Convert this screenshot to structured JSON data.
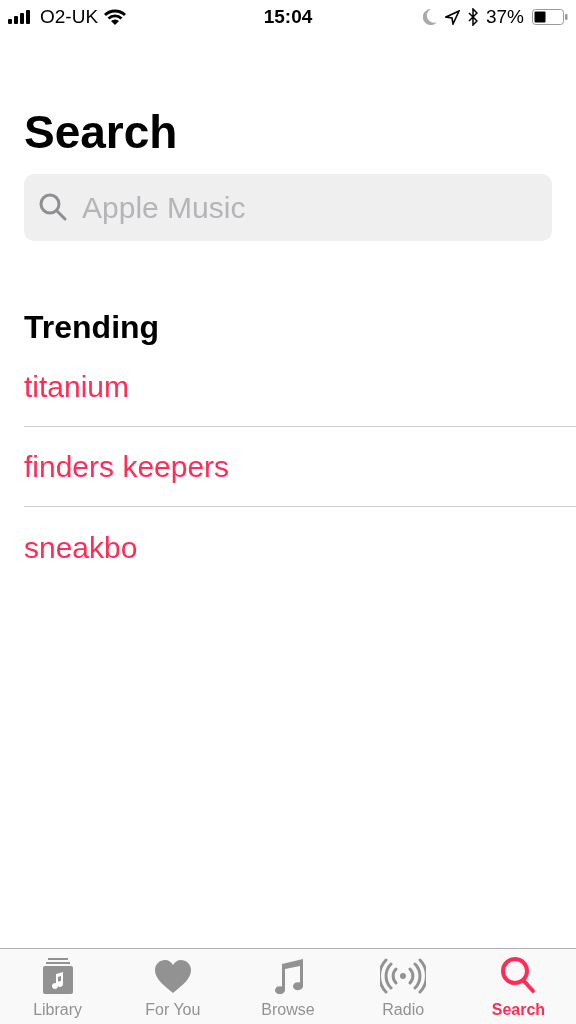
{
  "status_bar": {
    "carrier": "O2-UK",
    "time": "15:04",
    "battery": "37%"
  },
  "title": "Search",
  "search": {
    "placeholder": "Apple Music"
  },
  "section": {
    "title": "Trending",
    "items": [
      "titanium",
      "finders keepers",
      "sneakbo"
    ]
  },
  "tabs": [
    {
      "label": "Library",
      "kind": "library",
      "selected": false
    },
    {
      "label": "For You",
      "kind": "heart",
      "selected": false
    },
    {
      "label": "Browse",
      "kind": "note",
      "selected": false
    },
    {
      "label": "Radio",
      "kind": "radio",
      "selected": false
    },
    {
      "label": "Search",
      "kind": "search",
      "selected": true
    }
  ]
}
